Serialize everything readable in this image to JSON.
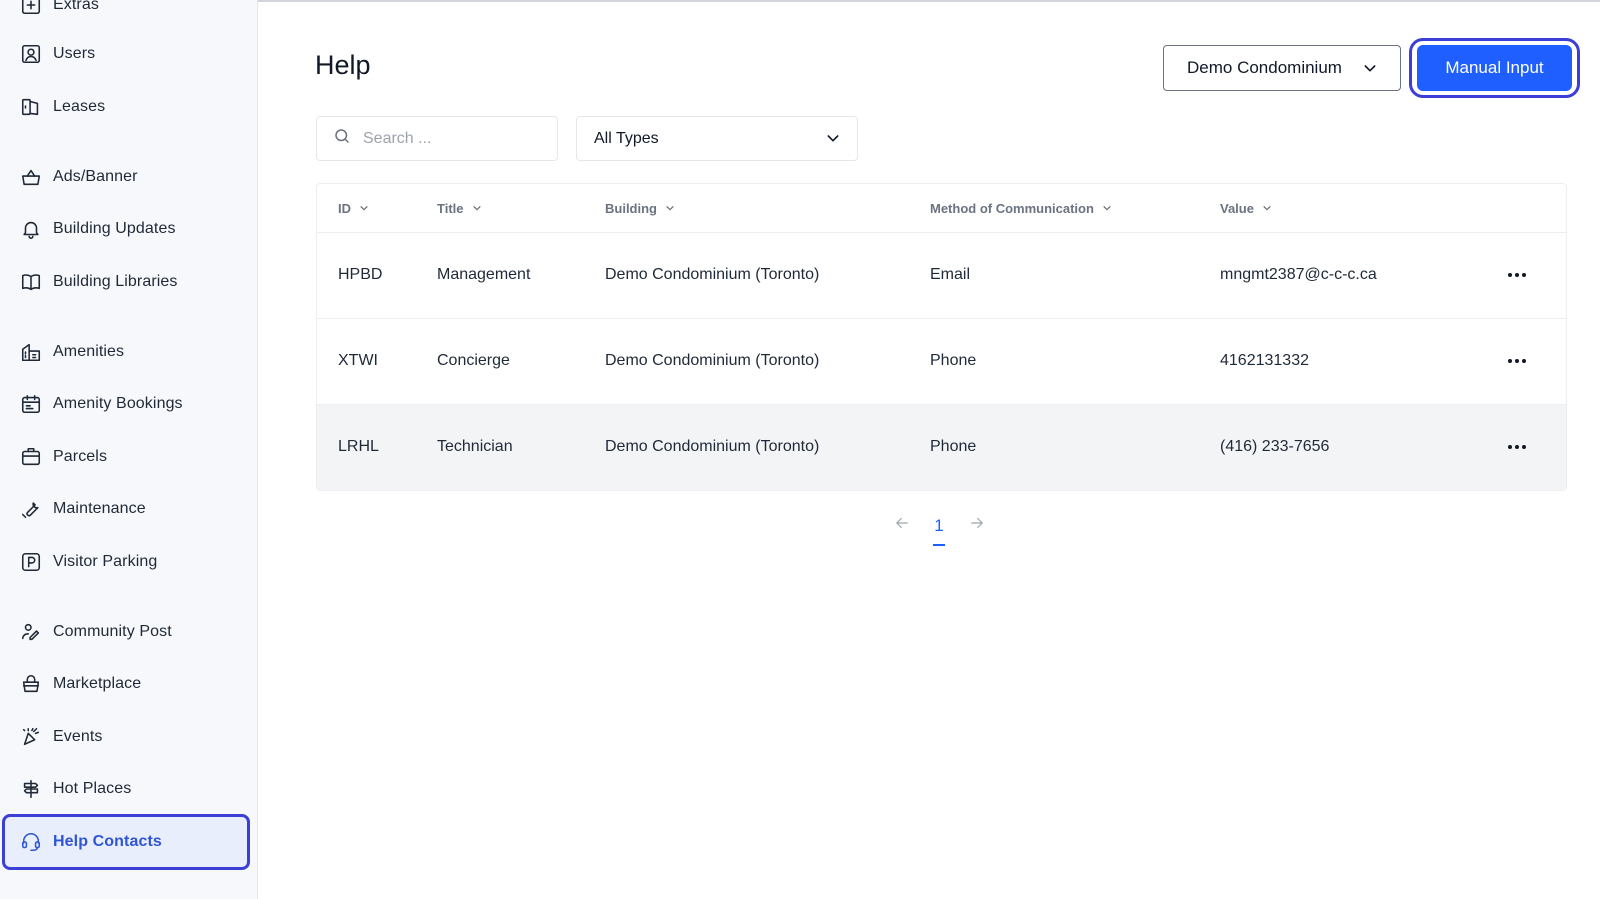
{
  "sidebar": {
    "items": [
      {
        "label": "Extras",
        "icon": "plus-square-icon"
      },
      {
        "label": "Users",
        "icon": "user-square-icon"
      },
      {
        "label": "Leases",
        "icon": "leases-icon"
      },
      {
        "label": "Ads/Banner",
        "icon": "basket-icon"
      },
      {
        "label": "Building Updates",
        "icon": "bell-icon"
      },
      {
        "label": "Building Libraries",
        "icon": "book-icon"
      },
      {
        "label": "Amenities",
        "icon": "building-icon"
      },
      {
        "label": "Amenity Bookings",
        "icon": "calendar-icon"
      },
      {
        "label": "Parcels",
        "icon": "package-icon"
      },
      {
        "label": "Maintenance",
        "icon": "wrench-icon"
      },
      {
        "label": "Visitor Parking",
        "icon": "parking-icon"
      },
      {
        "label": "Community Post",
        "icon": "community-icon"
      },
      {
        "label": "Marketplace",
        "icon": "shopping-basket-icon"
      },
      {
        "label": "Events",
        "icon": "party-icon"
      },
      {
        "label": "Hot Places",
        "icon": "signpost-icon"
      },
      {
        "label": "Help Contacts",
        "icon": "headset-icon",
        "active": true
      }
    ]
  },
  "header": {
    "title": "Help",
    "building_select": "Demo Condominium",
    "manual_input_label": "Manual Input"
  },
  "filters": {
    "search_placeholder": "Search ...",
    "type_select": "All Types"
  },
  "table": {
    "columns": [
      "ID",
      "Title",
      "Building",
      "Method of Communication",
      "Value"
    ],
    "rows": [
      {
        "id": "HPBD",
        "title": "Management",
        "building": "Demo Condominium (Toronto)",
        "method": "Email",
        "value": "mngmt2387@c-c-c.ca"
      },
      {
        "id": "XTWI",
        "title": "Concierge",
        "building": "Demo Condominium (Toronto)",
        "method": "Phone",
        "value": "4162131332"
      },
      {
        "id": "LRHL",
        "title": "Technician",
        "building": "Demo Condominium (Toronto)",
        "method": "Phone",
        "value": "(416) 233-7656"
      }
    ]
  },
  "pagination": {
    "current_page": "1"
  },
  "colors": {
    "accent": "#1f5eff",
    "highlight_outline": "#3b3fd6",
    "active_text": "#2f55d4",
    "sidebar_bg": "#f7f8fb",
    "row_highlight": "#f3f4f6"
  }
}
